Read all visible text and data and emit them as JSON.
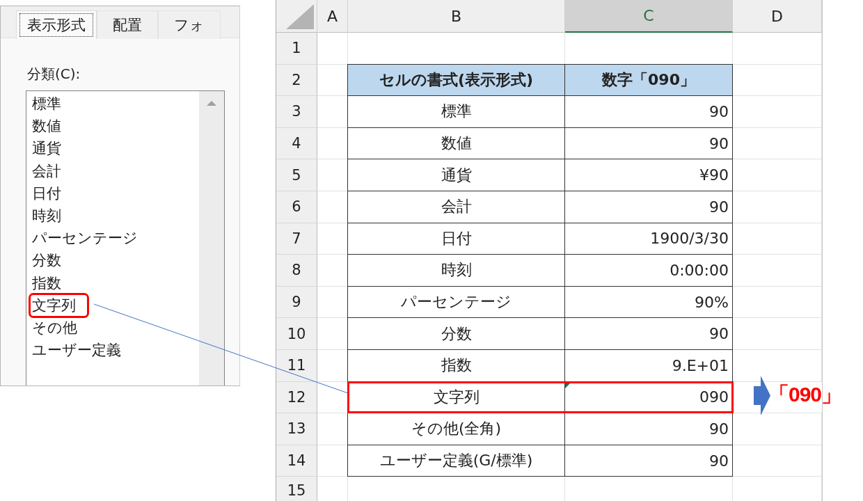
{
  "dialog": {
    "tabs": [
      {
        "label": "表示形式",
        "selected": true
      },
      {
        "label": "配置",
        "selected": false
      },
      {
        "label": "フォ",
        "selected": false
      }
    ],
    "category_label": "分類(C):",
    "categories": [
      {
        "label": "標準",
        "highlighted": false
      },
      {
        "label": "数値",
        "highlighted": false
      },
      {
        "label": "通貨",
        "highlighted": false
      },
      {
        "label": "会計",
        "highlighted": false
      },
      {
        "label": "日付",
        "highlighted": false
      },
      {
        "label": "時刻",
        "highlighted": false
      },
      {
        "label": "パーセンテージ",
        "highlighted": false
      },
      {
        "label": "分数",
        "highlighted": false
      },
      {
        "label": "指数",
        "highlighted": false
      },
      {
        "label": "文字列",
        "highlighted": true
      },
      {
        "label": "その他",
        "highlighted": false
      },
      {
        "label": "ユーザー定義",
        "highlighted": false
      }
    ]
  },
  "sheet": {
    "columns": [
      {
        "label": "A",
        "selected": false
      },
      {
        "label": "B",
        "selected": false
      },
      {
        "label": "C",
        "selected": true
      },
      {
        "label": "D",
        "selected": false
      }
    ],
    "rows": [
      {
        "number": "1",
        "kind": "empty",
        "highlighted": false,
        "error_marker": false
      },
      {
        "number": "2",
        "kind": "header",
        "cells": [
          "セルの書式(表示形式)",
          "数字「090」"
        ],
        "highlighted": false,
        "error_marker": false
      },
      {
        "number": "3",
        "kind": "data",
        "cells": [
          "標準",
          "90"
        ],
        "highlighted": false,
        "error_marker": false
      },
      {
        "number": "4",
        "kind": "data",
        "cells": [
          "数値",
          "90"
        ],
        "highlighted": false,
        "error_marker": false
      },
      {
        "number": "5",
        "kind": "data",
        "cells": [
          "通貨",
          "¥90"
        ],
        "highlighted": false,
        "error_marker": false
      },
      {
        "number": "6",
        "kind": "data",
        "cells": [
          "会計",
          "90"
        ],
        "highlighted": false,
        "error_marker": false
      },
      {
        "number": "7",
        "kind": "data",
        "cells": [
          "日付",
          "1900/3/30"
        ],
        "highlighted": false,
        "error_marker": false
      },
      {
        "number": "8",
        "kind": "data",
        "cells": [
          "時刻",
          "0:00:00"
        ],
        "highlighted": false,
        "error_marker": false
      },
      {
        "number": "9",
        "kind": "data",
        "cells": [
          "パーセンテージ",
          "90%"
        ],
        "highlighted": false,
        "error_marker": false
      },
      {
        "number": "10",
        "kind": "data",
        "cells": [
          "分数",
          "90"
        ],
        "highlighted": false,
        "error_marker": false
      },
      {
        "number": "11",
        "kind": "data",
        "cells": [
          "指数",
          "9.E+01"
        ],
        "highlighted": false,
        "error_marker": false
      },
      {
        "number": "12",
        "kind": "data",
        "cells": [
          "文字列",
          "090"
        ],
        "highlighted": true,
        "error_marker": true
      },
      {
        "number": "13",
        "kind": "data",
        "cells": [
          "その他(全角)",
          "90"
        ],
        "highlighted": false,
        "error_marker": false
      },
      {
        "number": "14",
        "kind": "data",
        "cells": [
          "ユーザー定義(G/標準)",
          "90"
        ],
        "highlighted": false,
        "error_marker": false
      },
      {
        "number": "15",
        "kind": "empty",
        "highlighted": false,
        "error_marker": false
      }
    ]
  },
  "callout": {
    "text": "「090」"
  }
}
